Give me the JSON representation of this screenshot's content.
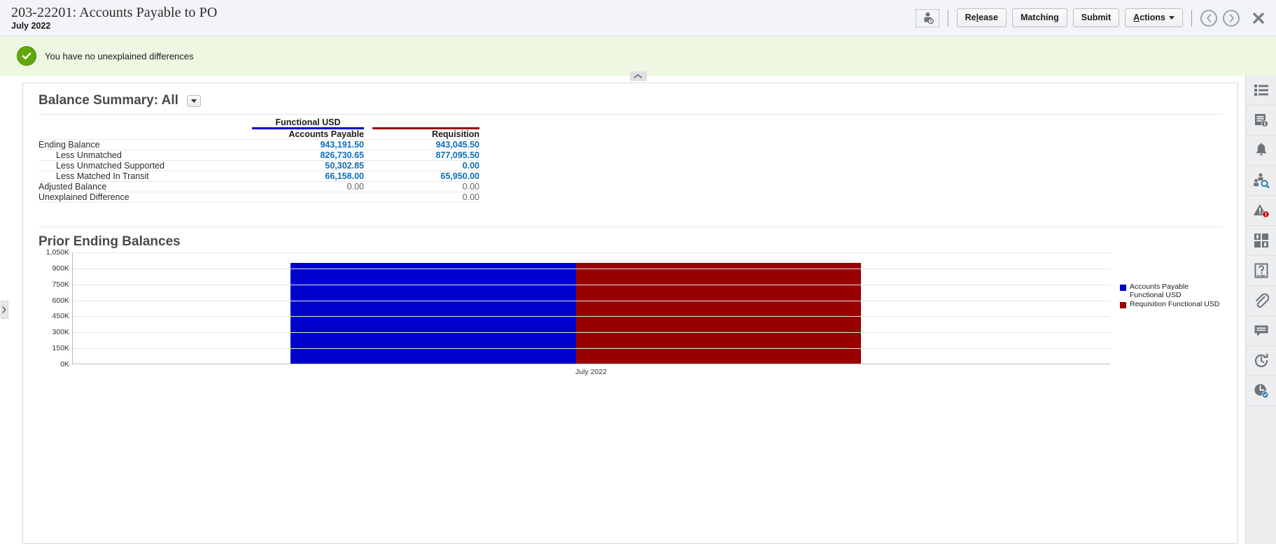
{
  "header": {
    "title": "203-22201: Accounts Payable to PO",
    "period": "July 2022",
    "user_icon": "user-assign-icon",
    "buttons": {
      "release_pre": "Re",
      "release_accel": "l",
      "release_post": "ease",
      "matching": "Matching",
      "submit": "Submit",
      "actions_accel": "A",
      "actions_post": "ctions"
    },
    "nav": {
      "prev_icon": "chevron-left-icon",
      "next_icon": "chevron-right-icon",
      "close_icon": "close-icon"
    }
  },
  "banner": {
    "icon": "success-check-icon",
    "message": "You have no unexplained differences",
    "collapse_icon": "collapse-up-icon"
  },
  "left_handle": {
    "icon": "expand-right-icon"
  },
  "balance_summary": {
    "title": "Balance Summary: All",
    "dropdown_icon": "chevron-down-icon",
    "group_header": "Functional USD",
    "columns": [
      {
        "label": "Accounts Payable",
        "color": "#0000cc"
      },
      {
        "label": "Requisition",
        "color": "#990000"
      }
    ],
    "rows": [
      {
        "label": "Ending Balance",
        "indent": false,
        "ap": "943,191.50",
        "req": "943,045.50",
        "link": true
      },
      {
        "label": "Less Unmatched",
        "indent": true,
        "ap": "826,730.65",
        "req": "877,095.50",
        "link": true
      },
      {
        "label": "Less Unmatched Supported",
        "indent": true,
        "ap": "50,302.85",
        "req": "0.00",
        "link": true
      },
      {
        "label": "Less Matched In Transit",
        "indent": true,
        "ap": "66,158.00",
        "req": "65,950.00",
        "link": true
      },
      {
        "label": "Adjusted Balance",
        "indent": false,
        "ap": "0.00",
        "req": "0.00",
        "link": false
      },
      {
        "label": "Unexplained Difference",
        "indent": false,
        "ap": "",
        "req": "0.00",
        "link": false
      }
    ]
  },
  "chart_data": {
    "type": "bar",
    "title": "Prior Ending Balances",
    "categories": [
      "July 2022"
    ],
    "series": [
      {
        "name": "Accounts Payable Functional USD",
        "color": "#0000cc",
        "values": [
          943191.5
        ]
      },
      {
        "name": "Requisition Functional USD",
        "color": "#990000",
        "values": [
          943045.5
        ]
      }
    ],
    "legend": [
      "Accounts Payable Functional USD",
      "Requisition Functional USD"
    ],
    "legend_position": "right",
    "xlabel": "",
    "ylabel": "",
    "ylim": [
      0,
      1050000
    ],
    "yticks": [
      "1,050K",
      "900K",
      "750K",
      "600K",
      "450K",
      "300K",
      "150K",
      "0K"
    ],
    "ytick_values": [
      1050000,
      900000,
      750000,
      600000,
      450000,
      300000,
      150000,
      0
    ],
    "grid": true
  },
  "rail": {
    "items": [
      {
        "icon": "list-icon"
      },
      {
        "icon": "document-info-icon"
      },
      {
        "icon": "bell-icon"
      },
      {
        "icon": "users-search-icon"
      },
      {
        "icon": "alert-warning-icon",
        "badge": true
      },
      {
        "icon": "grid-panels-icon"
      },
      {
        "icon": "help-question-icon"
      },
      {
        "icon": "attachment-paperclip-icon"
      },
      {
        "icon": "comment-icon"
      },
      {
        "icon": "history-refresh-icon"
      },
      {
        "icon": "clock-info-icon"
      }
    ]
  }
}
